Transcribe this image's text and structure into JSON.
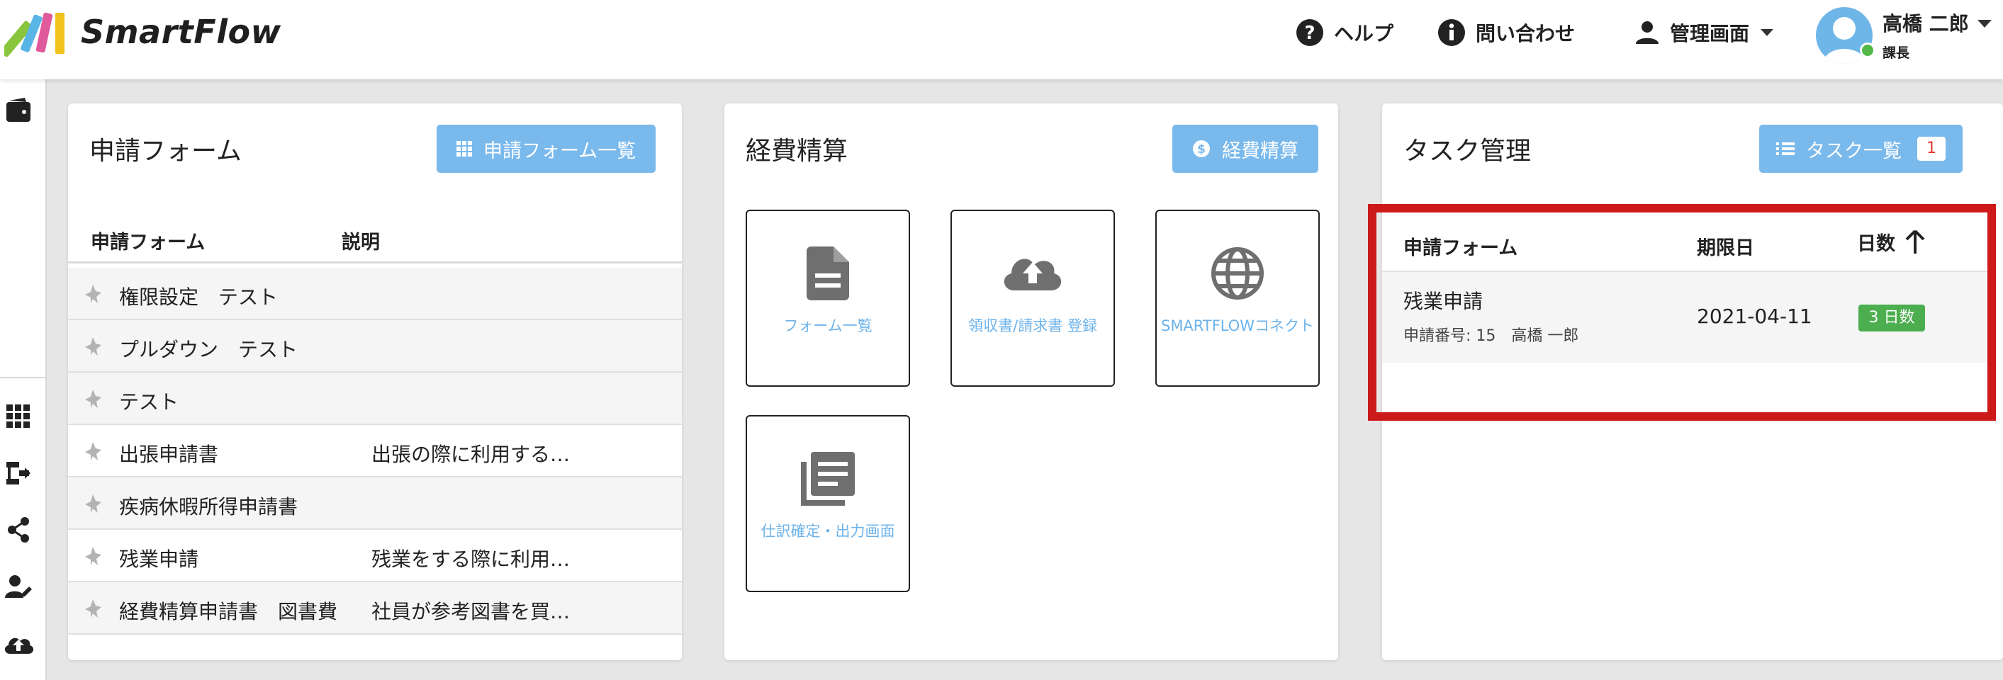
{
  "app": {
    "brand": "SmartFlow"
  },
  "header": {
    "help": "ヘルプ",
    "contact": "問い合わせ",
    "admin": "管理画面",
    "user": {
      "name": "高橋 二郎",
      "role": "課長"
    }
  },
  "forms_card": {
    "title": "申請フォーム",
    "button": "申請フォーム一覧",
    "columns": [
      "申請フォーム",
      "説明"
    ],
    "rows": [
      {
        "name": "権限設定　テスト",
        "desc": ""
      },
      {
        "name": "プルダウン　テスト",
        "desc": ""
      },
      {
        "name": "テスト",
        "desc": ""
      },
      {
        "name": "出張申請書",
        "desc": "出張の際に利用する…"
      },
      {
        "name": "疾病休暇所得申請書",
        "desc": ""
      },
      {
        "name": "残業申請",
        "desc": "残業をする際に利用…"
      },
      {
        "name": "経費精算申請書　図書費",
        "desc": "社員が参考図書を買…"
      }
    ]
  },
  "expense_card": {
    "title": "経費精算",
    "button": "経費精算",
    "tiles": [
      {
        "label": "フォーム一覧",
        "icon": "document-icon"
      },
      {
        "label": "領収書/請求書 登録",
        "icon": "cloud-upload-icon"
      },
      {
        "label": "SMARTFLOWコネクト",
        "icon": "globe-icon"
      },
      {
        "label": "仕訳確定・出力画面",
        "icon": "library-icon"
      }
    ]
  },
  "task_card": {
    "title": "タスク管理",
    "button": "タスク一覧",
    "count": "1",
    "columns": {
      "form": "申請フォーム",
      "due": "期限日",
      "days": "日数"
    },
    "rows": [
      {
        "form": "残業申請",
        "meta": "申請番号: 15　高橋 一郎",
        "due": "2021-04-11",
        "days": "3 日数"
      }
    ]
  },
  "colors": {
    "accent": "#7ab9ec",
    "link": "#6db3ea",
    "highlight": "#cc1a1a",
    "badge": "#4cae4f"
  }
}
